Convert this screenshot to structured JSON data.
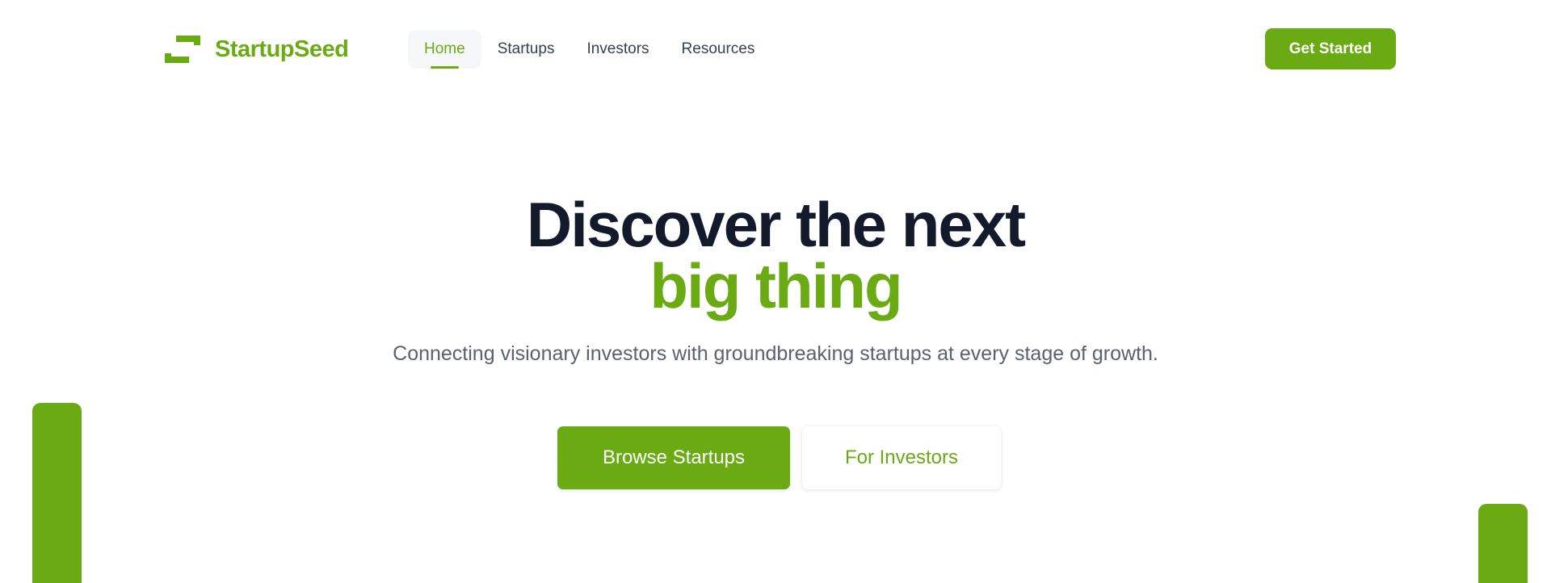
{
  "brand": {
    "name": "StartupSeed",
    "logo_icon": "seed-logo-icon",
    "accent_color": "#6aab14"
  },
  "nav": {
    "items": [
      {
        "label": "Home",
        "active": true
      },
      {
        "label": "Startups",
        "active": false
      },
      {
        "label": "Investors",
        "active": false
      },
      {
        "label": "Resources",
        "active": false
      }
    ],
    "cta_label": "Get Started"
  },
  "hero": {
    "title_line1": "Discover the next",
    "title_line2": "big thing",
    "subtitle": "Connecting visionary investors with groundbreaking startups at every stage of growth.",
    "primary_button": "Browse Startups",
    "secondary_button": "For Investors"
  },
  "colors": {
    "heading": "#131a2b",
    "accent": "#6aab14",
    "text_muted": "#5b6170"
  }
}
